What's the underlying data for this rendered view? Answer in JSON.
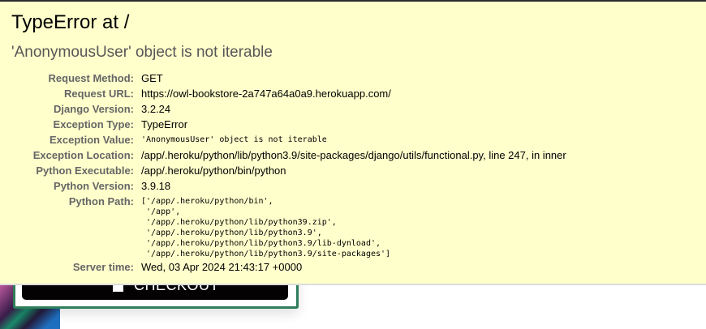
{
  "title": "TypeError at /",
  "subtitle": "'AnonymousUser' object is not iterable",
  "meta": [
    {
      "label": "Request Method:",
      "value": "GET"
    },
    {
      "label": "Request URL:",
      "value": "https://owl-bookstore-2a747a64a0a9.herokuapp.com/"
    },
    {
      "label": "Django Version:",
      "value": "3.2.24"
    },
    {
      "label": "Exception Type:",
      "value": "TypeError"
    },
    {
      "label": "Exception Value:",
      "value": "'AnonymousUser' object is not iterable"
    },
    {
      "label": "Exception Location:",
      "value": "/app/.heroku/python/lib/python3.9/site-packages/django/utils/functional.py, line 247, in inner"
    },
    {
      "label": "Python Executable:",
      "value": "/app/.heroku/python/bin/python"
    },
    {
      "label": "Python Version:",
      "value": "3.9.18"
    },
    {
      "label": "Python Path:",
      "value": "['/app/.heroku/python/bin',\n '/app',\n '/app/.heroku/python/lib/python39.zip',\n '/app/.heroku/python/lib/python3.9',\n '/app/.heroku/python/lib/python3.9/lib-dynload',\n '/app/.heroku/python/lib/python3.9/site-packages']"
    },
    {
      "label": "Server time:",
      "value": "Wed, 03 Apr 2024 21:43:17 +0000"
    }
  ],
  "underlying": {
    "checkout_label": "CHECKOUT"
  },
  "colors": {
    "summary_bg": "#ffffcc",
    "card_border": "#2e7d5b"
  }
}
